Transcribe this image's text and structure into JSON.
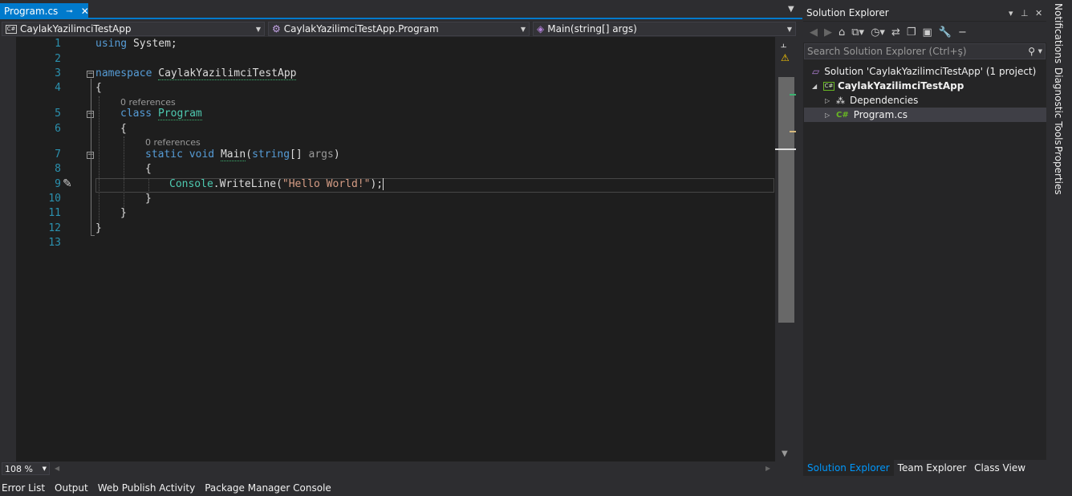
{
  "tab": {
    "label": "Program.cs",
    "pin_icon": "pin-icon",
    "close_icon": "close-icon"
  },
  "navbar": {
    "project": "CaylakYazilimciTestApp",
    "class": "CaylakYazilimciTestApp.Program",
    "member": "Main(string[] args)"
  },
  "code": {
    "line_numbers": [
      "1",
      "2",
      "3",
      "4",
      "5",
      "6",
      "7",
      "8",
      "9",
      "10",
      "11",
      "12",
      "13"
    ],
    "l1_kw": "using",
    "l1_rest": " System;",
    "l3_kw": "namespace",
    "l3_name": "CaylakYazilimciTestApp",
    "l4": "{",
    "ref1": "0 references",
    "l5_kw": "class",
    "l5_name": "Program",
    "l6": "{",
    "ref2": "0 references",
    "l7_kw1": "static",
    "l7_kw2": "void",
    "l7_name": "Main",
    "l7_p1": "(",
    "l7_kw3": "string",
    "l7_p2": "[] ",
    "l7_arg": "args",
    "l7_p3": ")",
    "l8": "{",
    "l9_type": "Console",
    "l9_mid": ".WriteLine(",
    "l9_str": "\"Hello World!\"",
    "l9_end": ");",
    "l10": "}",
    "l11": "}",
    "l12": "}"
  },
  "zoom": "108 %",
  "bottom_tabs": [
    "Error List",
    "Output",
    "Web Publish Activity",
    "Package Manager Console"
  ],
  "solution_explorer": {
    "title": "Solution Explorer",
    "search_placeholder": "Search Solution Explorer (Ctrl+ş)",
    "solution": "Solution 'CaylakYazilimciTestApp' (1 project)",
    "project": "CaylakYazilimciTestApp",
    "dependencies": "Dependencies",
    "file": "Program.cs",
    "tabs": [
      "Solution Explorer",
      "Team Explorer",
      "Class View"
    ]
  },
  "side_tabs": [
    "Notifications",
    "Diagnostic Tools",
    "Properties"
  ]
}
